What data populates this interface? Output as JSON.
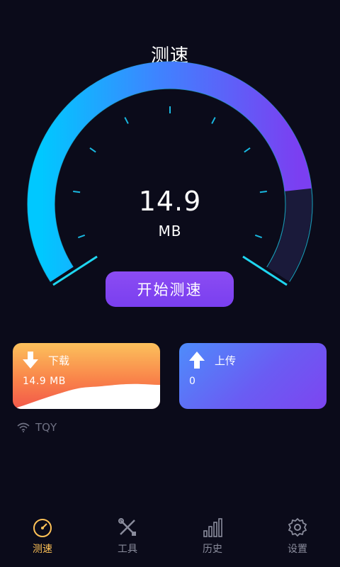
{
  "header": {
    "title": "测速"
  },
  "gauge": {
    "value": "14.9",
    "unit": "MB",
    "progress": 0.84
  },
  "start_button": {
    "label": "开始测速"
  },
  "download": {
    "label": "下载",
    "value": "14.9 MB"
  },
  "upload": {
    "label": "上传",
    "value": "0"
  },
  "network": {
    "ssid": "TQY"
  },
  "tabs": [
    {
      "label": "测速",
      "icon": "speedometer-icon",
      "active": true
    },
    {
      "label": "工具",
      "icon": "tools-icon",
      "active": false
    },
    {
      "label": "历史",
      "icon": "bar-chart-icon",
      "active": false
    },
    {
      "label": "设置",
      "icon": "gear-icon",
      "active": false
    }
  ],
  "colors": {
    "background": "#0b0b1a",
    "accent_cyan": "#00cfff",
    "accent_purple": "#7a3ff0",
    "active_tab": "#ffc257",
    "inactive_tab": "#8a8c9c"
  }
}
